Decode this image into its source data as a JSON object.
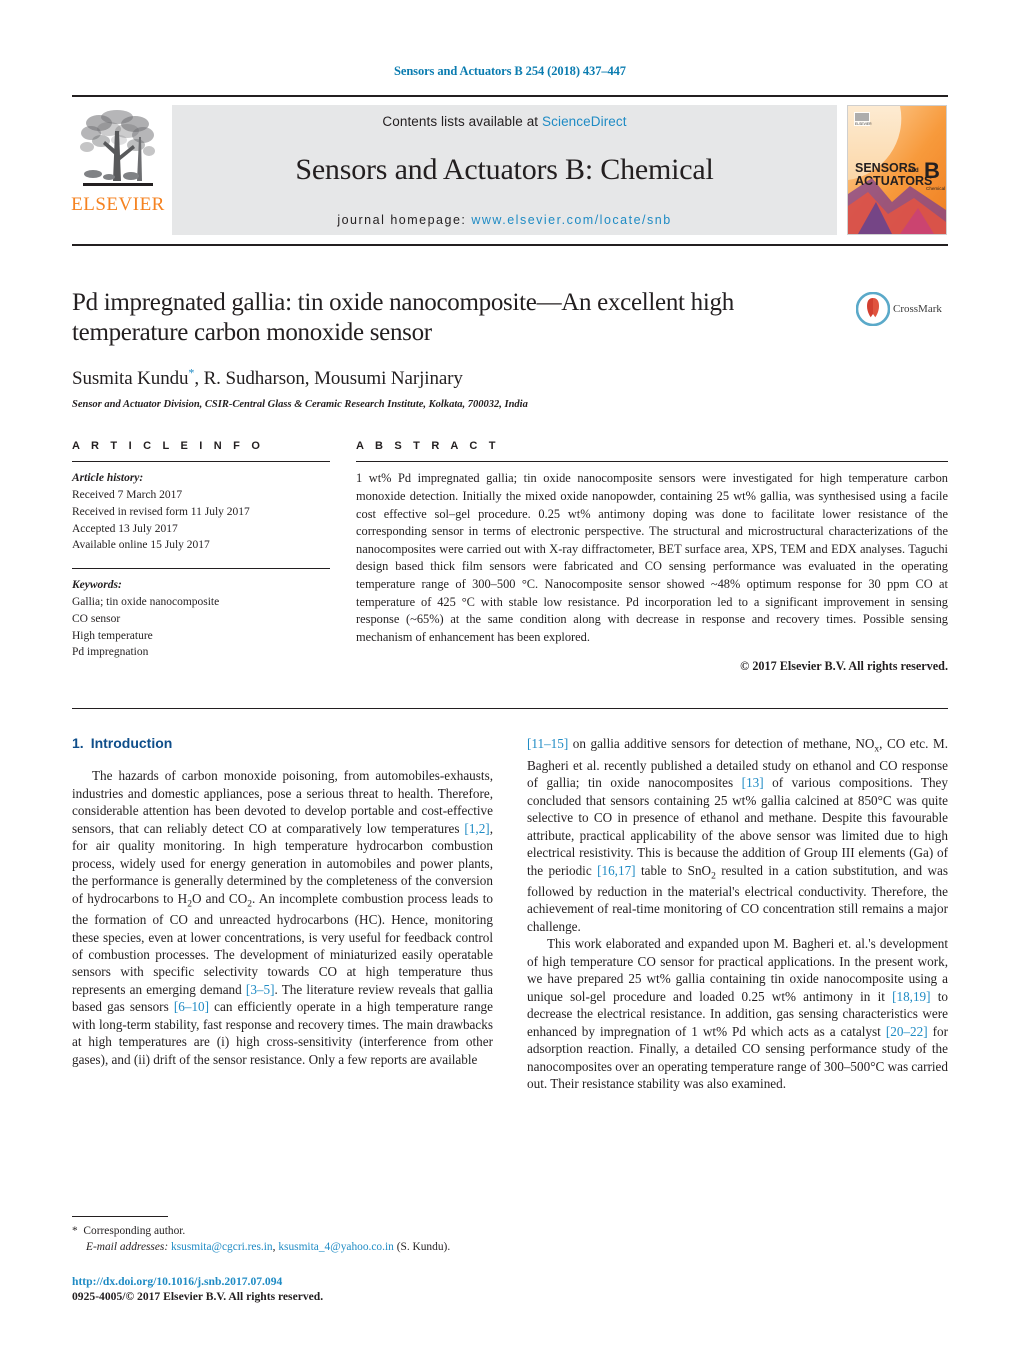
{
  "running_head": "Sensors and Actuators B 254 (2018) 437–447",
  "masthead": {
    "elsevier_wordmark": "ELSEVIER",
    "contents_prefix": "Contents lists available at ",
    "contents_link": "ScienceDirect",
    "journal_title": "Sensors and Actuators B: Chemical",
    "homepage_prefix": "journal homepage: ",
    "homepage_url": "www.elsevier.com/locate/snb",
    "cover_line1": "SENSORS",
    "cover_and": "and",
    "cover_line2": "ACTUATORS",
    "cover_letter": "B",
    "cover_sub": "Chemical"
  },
  "article": {
    "title": "Pd impregnated gallia: tin oxide nanocomposite—An excellent high temperature carbon monoxide sensor",
    "authors": "Susmita Kundu, R. Sudharson, Mousumi Narjinary",
    "author_star": "*",
    "affiliation": "Sensor and Actuator Division, CSIR-Central Glass & Ceramic Research Institute, Kolkata, 700032, India",
    "crossmark_label": "CrossMark"
  },
  "article_info": {
    "heading": "A R T I C L E   I N F O",
    "history_label": "Article history:",
    "history": [
      "Received 7 March 2017",
      "Received in revised form 11 July 2017",
      "Accepted 13 July 2017",
      "Available online 15 July 2017"
    ],
    "keywords_label": "Keywords:",
    "keywords": [
      "Gallia; tin oxide nanocomposite",
      "CO sensor",
      "High temperature",
      "Pd impregnation"
    ]
  },
  "abstract": {
    "heading": "A B S T R A C T",
    "text": "1 wt% Pd impregnated gallia; tin oxide nanocomposite sensors were investigated for high temperature carbon monoxide detection. Initially the mixed oxide nanopowder, containing 25 wt% gallia, was synthesised using a facile cost effective sol–gel procedure. 0.25 wt% antimony doping was done to facilitate lower resistance of the corresponding sensor in terms of electronic perspective. The structural and microstructural characterizations of the nanocomposites were carried out with X-ray diffractometer, BET surface area, XPS, TEM and EDX analyses. Taguchi design based thick film sensors were fabricated and CO sensing performance was evaluated in the operating temperature range of 300–500 °C. Nanocomposite sensor showed ~48% optimum response for 30 ppm CO at temperature of 425 °C with stable low resistance. Pd incorporation led to a significant improvement in sensing response (~65%) at the same condition along with decrease in response and recovery times. Possible sensing mechanism of enhancement has been explored.",
    "copyright": "© 2017 Elsevier B.V. All rights reserved."
  },
  "introduction": {
    "number": "1.",
    "title": "Introduction",
    "left_para_1_a": "The hazards of carbon monoxide poisoning, from automobiles-exhausts, industries and domestic appliances, pose a serious threat to health. Therefore, considerable attention has been devoted to develop portable and cost-effective sensors, that can reliably detect CO at comparatively low temperatures ",
    "left_ref_1": "[1,2]",
    "left_para_1_b": ", for air quality monitoring. In high temperature hydrocarbon combustion process, widely used for energy generation in automobiles and power plants, the performance is generally determined by the completeness of the conversion of hydrocarbons to H",
    "left_sub_1": "2",
    "left_para_1_c": "O and CO",
    "left_sub_2": "2",
    "left_para_1_d": ". An incomplete combustion process leads to the formation of CO and unreacted hydrocarbons (HC). Hence, monitoring these species, even at lower concentrations, is very useful for feedback control of combustion processes. The development of miniaturized easily operatable sensors with specific selectivity towards CO at high temperature thus represents an emerging demand ",
    "left_ref_2": "[3–5]",
    "left_para_1_e": ". The literature review reveals that gallia based gas sensors ",
    "left_ref_3": "[6–10]",
    "left_para_1_f": " can efficiently operate in a high temperature range with long-term stability, fast response and recovery times. The main drawbacks at high temperatures are (i) high cross-sensitivity (interference from other gases), and (ii) drift of the sensor resistance. Only a few reports are available ",
    "right_ref_1": "[11–15]",
    "right_para_1_a": " on gallia additive sensors for detection of methane, NO",
    "right_sub_1": "x",
    "right_para_1_b": ", CO etc. M. Bagheri et al. recently published a detailed study on ethanol and CO response of gallia; tin oxide nanocomposites ",
    "right_ref_2": "[13]",
    "right_para_1_c": " of various compositions. They concluded that sensors containing 25 wt% gallia calcined at 850°C was quite selective to CO in presence of ethanol and methane. Despite this favourable attribute, practical applicability of the above sensor was limited due to high electrical resistivity. This is because the addition of Group III elements (Ga) of the periodic ",
    "right_ref_3": "[16,17]",
    "right_para_1_d": " table to SnO",
    "right_sub_2": "2",
    "right_para_1_e": " resulted in a cation substitution, and was followed by reduction in the material's electrical conductivity. Therefore, the achievement of real-time monitoring of CO concentration still remains a major challenge.",
    "right_para_2_a": "This work elaborated and expanded upon M. Bagheri et. al.'s development of high temperature CO sensor for practical applications. In the present work, we have prepared 25 wt% gallia containing tin oxide nanocomposite using a unique sol-gel procedure and loaded 0.25 wt% antimony in it ",
    "right_ref_4": "[18,19]",
    "right_para_2_b": " to decrease the electrical resistance. In addition, gas sensing characteristics were enhanced by impregnation of 1 wt% Pd which acts as a catalyst ",
    "right_ref_5": "[20–22]",
    "right_para_2_c": " for adsorption reaction. Finally, a detailed CO sensing performance study of the nanocomposites over an operating temperature range of 300–500°C was carried out. Their resistance stability was also examined."
  },
  "footnote": {
    "star": "*",
    "corresponding": "Corresponding author.",
    "email_label": "E-mail addresses:",
    "email1": "ksusmita@cgcri.res.in",
    "email_sep": ", ",
    "email2": "ksusmita_4@yahoo.co.in",
    "email_suffix": " (S. Kundu).",
    "doi": "http://dx.doi.org/10.1016/j.snb.2017.07.094",
    "issn": "0925-4005/© 2017 Elsevier B.V. All rights reserved."
  },
  "colors": {
    "link": "#1f8bc4",
    "running_head": "#0b7cb0",
    "section_title": "#0f4e8a",
    "elsevier_orange": "#f58220",
    "masthead_bg": "#e6e7e8"
  }
}
